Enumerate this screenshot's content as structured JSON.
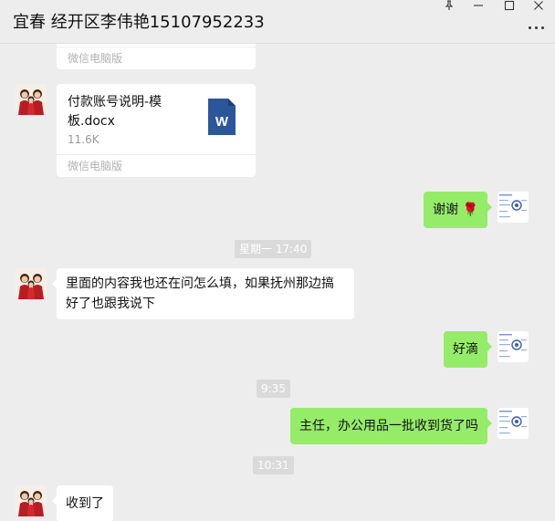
{
  "window": {
    "title": "宜春 经开区李伟艳15107952233"
  },
  "source_label": "微信电脑版",
  "messages": {
    "file": {
      "name": "付款账号说明-模板.docx",
      "size": "11.6K",
      "source": "微信电脑版"
    },
    "thanks": {
      "text": "谢谢",
      "emoji": "🌹"
    },
    "time1": "星期一 17:40",
    "left_long": "里面的内容我也还在问怎么填，如果抚州那边搞好了也跟我说下",
    "hao": "好滴",
    "time2": "9:35",
    "ask": "主任，办公用品一批收到货了吗",
    "time3": "10:31",
    "received": "收到了"
  }
}
